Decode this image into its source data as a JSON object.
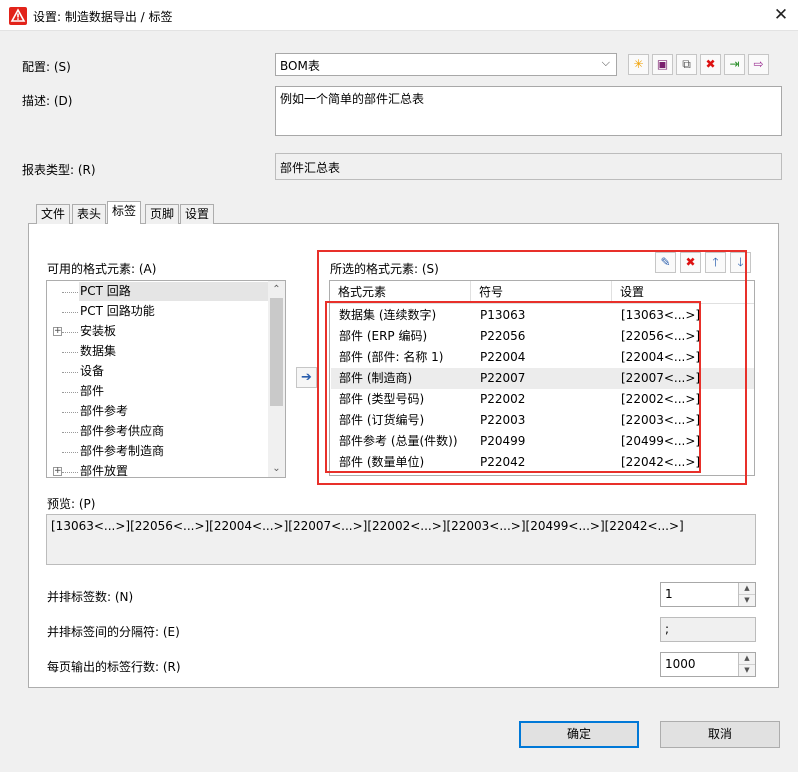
{
  "window": {
    "title": "设置: 制造数据导出 / 标签",
    "close_glyph": "✕"
  },
  "config": {
    "label": "配置: (S)",
    "value": "BOM表",
    "toolbar": [
      {
        "name": "new-icon",
        "glyph": "✳"
      },
      {
        "name": "save-icon",
        "glyph": "▣"
      },
      {
        "name": "copy-icon",
        "glyph": "⧉"
      },
      {
        "name": "delete-icon",
        "glyph": "✖"
      },
      {
        "name": "import-icon",
        "glyph": "⇥"
      },
      {
        "name": "export-icon",
        "glyph": "⇨"
      }
    ]
  },
  "description": {
    "label": "描述: (D)",
    "value": "例如一个简单的部件汇总表"
  },
  "report_type": {
    "label": "报表类型: (R)",
    "value": "部件汇总表"
  },
  "tabs": [
    {
      "label": "文件",
      "active": false
    },
    {
      "label": "表头",
      "active": false
    },
    {
      "label": "标签",
      "active": true
    },
    {
      "label": "页脚",
      "active": false
    },
    {
      "label": "设置",
      "active": false
    }
  ],
  "available": {
    "label": "可用的格式元素: (A)",
    "items": [
      {
        "label": "PCT 回路",
        "expandable": false,
        "selected": true
      },
      {
        "label": "PCT 回路功能",
        "expandable": false,
        "selected": false
      },
      {
        "label": "安装板",
        "expandable": true,
        "selected": false
      },
      {
        "label": "数据集",
        "expandable": false,
        "selected": false
      },
      {
        "label": "设备",
        "expandable": false,
        "selected": false
      },
      {
        "label": "部件",
        "expandable": false,
        "selected": false
      },
      {
        "label": "部件参考",
        "expandable": false,
        "selected": false
      },
      {
        "label": "部件参考供应商",
        "expandable": false,
        "selected": false
      },
      {
        "label": "部件参考制造商",
        "expandable": false,
        "selected": false
      },
      {
        "label": "部件放置",
        "expandable": true,
        "selected": false
      }
    ]
  },
  "selected": {
    "label": "所选的格式元素: (S)",
    "columns": [
      "格式元素",
      "符号",
      "设置"
    ],
    "rows": [
      [
        "数据集 (连续数字)",
        "P13063",
        "[13063<...>]"
      ],
      [
        "部件 (ERP 编码)",
        "P22056",
        "[22056<...>]"
      ],
      [
        "部件 (部件: 名称 1)",
        "P22004",
        "[22004<...>]"
      ],
      [
        "部件 (制造商)",
        "P22007",
        "[22007<...>]"
      ],
      [
        "部件 (类型号码)",
        "P22002",
        "[22002<...>]"
      ],
      [
        "部件 (订货编号)",
        "P22003",
        "[22003<...>]"
      ],
      [
        "部件参考 (总量(件数))",
        "P20499",
        "[20499<...>]"
      ],
      [
        "部件 (数量单位)",
        "P22042",
        "[22042<...>]"
      ]
    ],
    "highlighted_row": 3,
    "toolbar": [
      {
        "name": "edit-icon",
        "glyph": "✎"
      },
      {
        "name": "remove-icon",
        "glyph": "✖"
      },
      {
        "name": "move-up-icon",
        "glyph": "🡑"
      },
      {
        "name": "move-down-icon",
        "glyph": "🡓"
      }
    ]
  },
  "transfer_glyph": "➔",
  "preview": {
    "label": "预览: (P)",
    "value": "[13063<...>][22056<...>][22004<...>][22007<...>][22002<...>][22003<...>][20499<...>][22042<...>]"
  },
  "labels_side_by_side": {
    "label": "并排标签数: (N)",
    "value": "1"
  },
  "separator": {
    "label": "并排标签间的分隔符: (E)",
    "value": ";"
  },
  "rows_per_page": {
    "label": "每页输出的标签行数: (R)",
    "value": "1000"
  },
  "buttons": {
    "ok": "确定",
    "cancel": "取消"
  },
  "colors": {
    "highlight_box": "#e8302a",
    "default_button_border": "#0078d7",
    "app_icon": "#e2231a"
  }
}
